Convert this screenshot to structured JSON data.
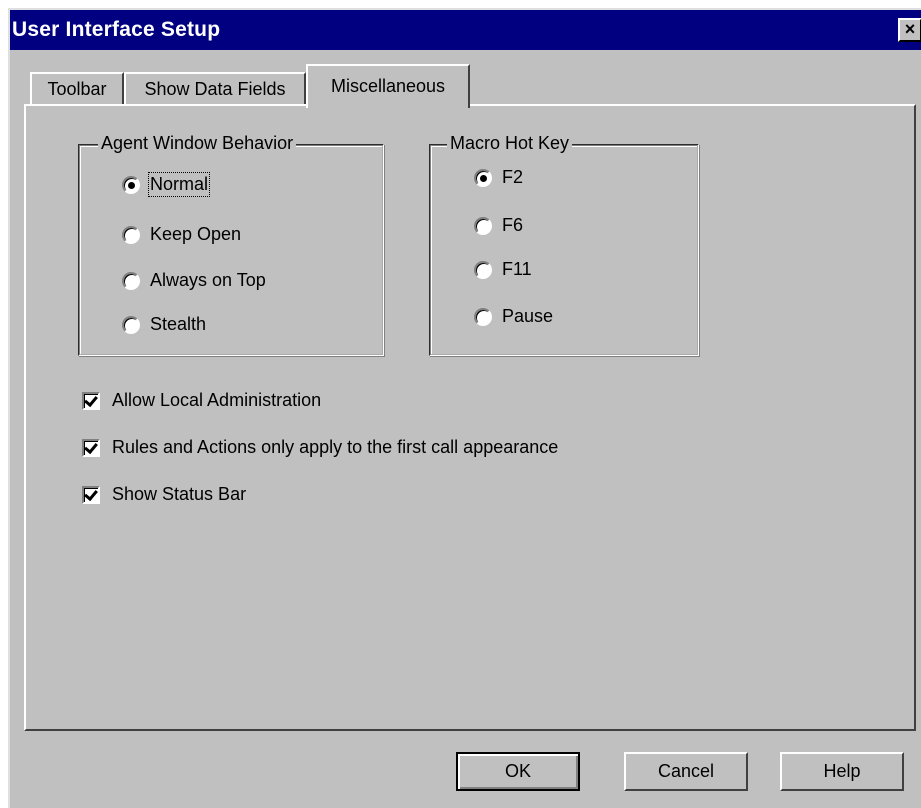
{
  "window": {
    "title": "User Interface Setup",
    "close_glyph": "×"
  },
  "tabs": [
    {
      "label": "Toolbar",
      "active": false
    },
    {
      "label": "Show Data Fields",
      "active": false
    },
    {
      "label": "Miscellaneous",
      "active": true
    }
  ],
  "agent_window_behavior": {
    "legend": "Agent Window Behavior",
    "options": [
      {
        "label": "Normal",
        "selected": true
      },
      {
        "label": "Keep Open",
        "selected": false
      },
      {
        "label": "Always on Top",
        "selected": false
      },
      {
        "label": "Stealth",
        "selected": false
      }
    ]
  },
  "macro_hot_key": {
    "legend": "Macro Hot Key",
    "options": [
      {
        "label": "F2",
        "selected": true
      },
      {
        "label": "F6",
        "selected": false
      },
      {
        "label": "F11",
        "selected": false
      },
      {
        "label": "Pause",
        "selected": false
      }
    ]
  },
  "checkboxes": [
    {
      "label": "Allow Local Administration",
      "checked": true
    },
    {
      "label": "Rules and Actions only apply to the first call appearance",
      "checked": true
    },
    {
      "label": "Show Status Bar",
      "checked": true
    }
  ],
  "buttons": {
    "ok": "OK",
    "cancel": "Cancel",
    "help": "Help"
  },
  "colors": {
    "title_bar": "#000080",
    "face": "#c0c0c0"
  }
}
